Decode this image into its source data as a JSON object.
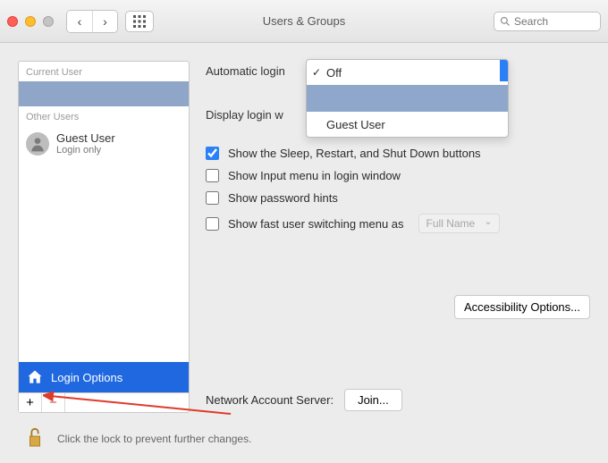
{
  "window": {
    "title": "Users & Groups",
    "search_placeholder": "Search"
  },
  "sidebar": {
    "sections": {
      "current": "Current User",
      "other": "Other Users"
    },
    "other_users": [
      {
        "name": "Guest User",
        "sub": "Login only"
      }
    ],
    "login_options": "Login Options",
    "plus": "+",
    "minus": "−"
  },
  "panel": {
    "auto_login_label": "Automatic login",
    "display_login_label": "Display login w",
    "dropdown": {
      "off": "Off",
      "guest": "Guest User"
    },
    "cb_sleep": "Show the Sleep, Restart, and Shut Down buttons",
    "cb_input": "Show Input menu in login window",
    "cb_hints": "Show password hints",
    "cb_fast": "Show fast user switching menu as",
    "fast_value": "Full Name",
    "accessibility": "Accessibility Options...",
    "network_label": "Network Account Server:",
    "join": "Join..."
  },
  "footer": {
    "lock_text": "Click the lock to prevent further changes."
  }
}
